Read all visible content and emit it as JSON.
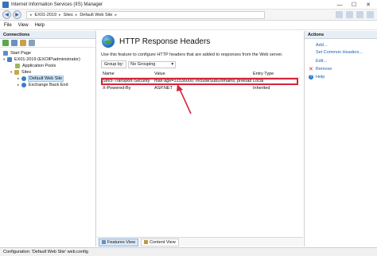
{
  "window": {
    "title": "Internet Information Services (IIS) Manager",
    "minimize": "—",
    "maximize": "☐",
    "close": "✕"
  },
  "address": {
    "crumbs": [
      "EX01-2019",
      "Sites",
      "Default Web Site"
    ],
    "sep": "▸"
  },
  "menu": [
    "File",
    "View",
    "Help"
  ],
  "connections": {
    "header": "Connections",
    "tree": [
      {
        "label": "Start Page"
      },
      {
        "label": "EX01-2019 (EXOIP\\administrator)"
      },
      {
        "label": "Application Pools"
      },
      {
        "label": "Sites"
      },
      {
        "label": "Default Web Site"
      },
      {
        "label": "Exchange Back End"
      }
    ]
  },
  "main": {
    "title": "HTTP Response Headers",
    "description": "Use this feature to configure HTTP headers that are added to responses from the Web server.",
    "group_by_label": "Group by:",
    "group_by_value": "No Grouping",
    "columns": [
      "Name",
      "Value",
      "Entry Type"
    ],
    "rows": [
      {
        "name": "Strict-Transport-Security",
        "value": "max-age=31536000; includeSubDomains; preload",
        "type": "Local"
      },
      {
        "name": "X-Powered-By",
        "value": "ASP.NET",
        "type": "Inherited"
      }
    ],
    "tabs": [
      "Features View",
      "Content View"
    ]
  },
  "actions": {
    "header": "Actions",
    "items": [
      "Add...",
      "Set Common Headers...",
      "Edit...",
      "Remove",
      "Help"
    ]
  },
  "status": "Configuration: 'Default Web Site' web.config",
  "colors": {
    "highlight": "#d6243a",
    "selection": "#cce4f7",
    "link": "#1a5fb4"
  }
}
